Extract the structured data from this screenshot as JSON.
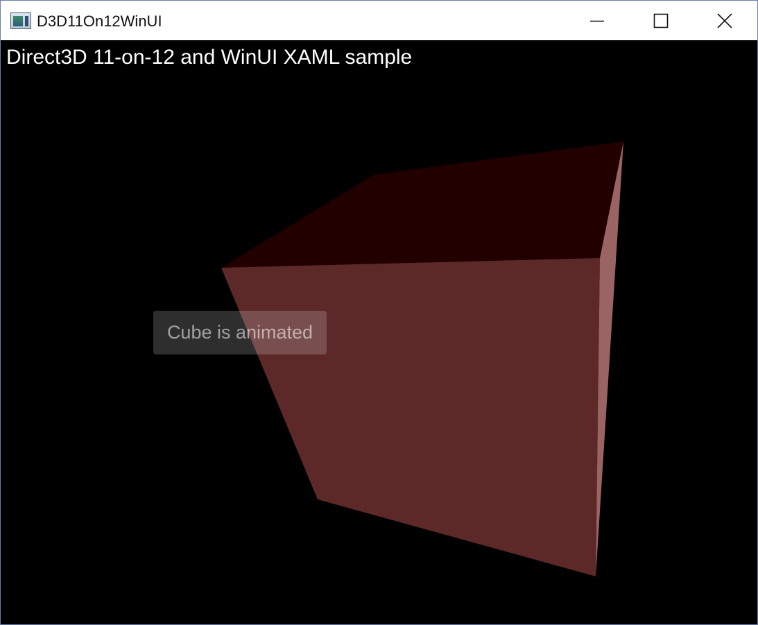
{
  "window": {
    "title": "D3D11On12WinUI",
    "icon": "app-window-icon",
    "controls": {
      "minimize_icon": "minimize-icon",
      "maximize_icon": "maximize-icon",
      "close_icon": "close-icon"
    }
  },
  "content": {
    "heading": "Direct3D 11-on-12 and WinUI XAML sample",
    "toggle_label": "Cube is animated",
    "background_color": "#000000",
    "cube": {
      "top_face_color": "#230000",
      "front_face_color": "#5c2828",
      "side_face_color": "#9a6464"
    }
  }
}
